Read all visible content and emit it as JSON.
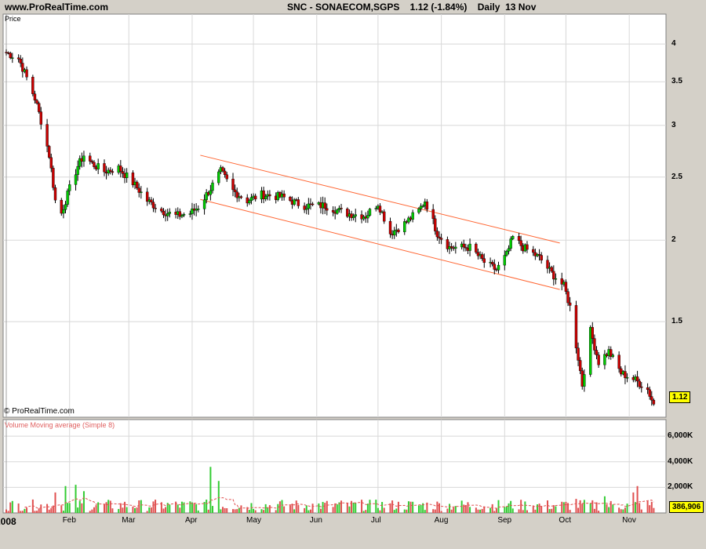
{
  "header": {
    "site": "www.ProRealTime.com",
    "ticker_line": "SNC - SONAECOM,SGPS    1.12 (-1.84%)    Daily  13 Nov"
  },
  "price_panel": {
    "label": "Price",
    "copyright": "© ProRealTime.com",
    "last_price_badge": "1.12"
  },
  "volume_panel": {
    "label": "Volume Moving average (Simple 8)",
    "last_volume_badge": "386,906"
  },
  "colors": {
    "background": "#ffffff",
    "frame": "#d4d0c8",
    "grid": "#d8d8d8",
    "up_candle": "#00cc00",
    "down_candle": "#cc0000",
    "volume_up": "#33cc33",
    "volume_down": "#e05050",
    "volume_ma": "#e05050",
    "channel": "#ff6633",
    "badge": "#ffff00"
  },
  "chart_data": {
    "type": "candlestick",
    "title": "SNC - SONAECOM,SGPS",
    "last": 1.12,
    "change_pct": -1.84,
    "date": "13 Nov",
    "y_scale": "log",
    "ylim": [
      1.1,
      4.3
    ],
    "y_ticks": [
      {
        "value": 4,
        "label": "4"
      },
      {
        "value": 3.5,
        "label": "3.5"
      },
      {
        "value": 3,
        "label": "3"
      },
      {
        "value": 2.5,
        "label": "2.5"
      },
      {
        "value": 2,
        "label": "2"
      },
      {
        "value": 1.5,
        "label": "1.5"
      }
    ],
    "x_range": [
      "2008-01-01",
      "2008-11-14"
    ],
    "x_ticks": [
      {
        "date": "2008-01-01",
        "label": "2008",
        "year": true
      },
      {
        "date": "2008-02-01",
        "label": "Feb"
      },
      {
        "date": "2008-03-01",
        "label": "Mar"
      },
      {
        "date": "2008-04-01",
        "label": "Apr"
      },
      {
        "date": "2008-05-01",
        "label": "May"
      },
      {
        "date": "2008-06-01",
        "label": "Jun"
      },
      {
        "date": "2008-07-01",
        "label": "Jul"
      },
      {
        "date": "2008-08-01",
        "label": "Aug"
      },
      {
        "date": "2008-09-01",
        "label": "Sep"
      },
      {
        "date": "2008-10-01",
        "label": "Oct"
      },
      {
        "date": "2008-11-01",
        "label": "Nov"
      }
    ],
    "volume_ylim": [
      0,
      6500000
    ],
    "volume_ticks": [
      {
        "value": 6000000,
        "label": "6,000K"
      },
      {
        "value": 4000000,
        "label": "4,000K"
      },
      {
        "value": 2000000,
        "label": "2,000K"
      }
    ],
    "close_anchors": [
      [
        "2008-01-01",
        3.88
      ],
      [
        "2008-01-07",
        3.8
      ],
      [
        "2008-01-11",
        3.55
      ],
      [
        "2008-01-15",
        3.3
      ],
      [
        "2008-01-18",
        3.05
      ],
      [
        "2008-01-22",
        2.7
      ],
      [
        "2008-01-25",
        2.3
      ],
      [
        "2008-01-28",
        2.2
      ],
      [
        "2008-01-31",
        2.35
      ],
      [
        "2008-02-05",
        2.6
      ],
      [
        "2008-02-08",
        2.7
      ],
      [
        "2008-02-12",
        2.62
      ],
      [
        "2008-02-18",
        2.55
      ],
      [
        "2008-02-25",
        2.58
      ],
      [
        "2008-03-03",
        2.45
      ],
      [
        "2008-03-10",
        2.3
      ],
      [
        "2008-03-17",
        2.22
      ],
      [
        "2008-03-24",
        2.18
      ],
      [
        "2008-03-31",
        2.2
      ],
      [
        "2008-04-04",
        2.25
      ],
      [
        "2008-04-10",
        2.4
      ],
      [
        "2008-04-15",
        2.55
      ],
      [
        "2008-04-21",
        2.38
      ],
      [
        "2008-04-28",
        2.3
      ],
      [
        "2008-05-05",
        2.35
      ],
      [
        "2008-05-15",
        2.33
      ],
      [
        "2008-05-25",
        2.26
      ],
      [
        "2008-06-05",
        2.26
      ],
      [
        "2008-06-15",
        2.2
      ],
      [
        "2008-06-25",
        2.18
      ],
      [
        "2008-07-01",
        2.28
      ],
      [
        "2008-07-07",
        2.05
      ],
      [
        "2008-07-14",
        2.12
      ],
      [
        "2008-07-21",
        2.22
      ],
      [
        "2008-07-24",
        2.3
      ],
      [
        "2008-07-30",
        2.05
      ],
      [
        "2008-08-05",
        1.95
      ],
      [
        "2008-08-15",
        1.95
      ],
      [
        "2008-08-22",
        1.85
      ],
      [
        "2008-08-28",
        1.8
      ],
      [
        "2008-09-02",
        1.9
      ],
      [
        "2008-09-05",
        2.02
      ],
      [
        "2008-09-10",
        1.95
      ],
      [
        "2008-09-18",
        1.88
      ],
      [
        "2008-09-24",
        1.78
      ],
      [
        "2008-09-30",
        1.7
      ],
      [
        "2008-10-03",
        1.58
      ],
      [
        "2008-10-06",
        1.38
      ],
      [
        "2008-10-09",
        1.2
      ],
      [
        "2008-10-13",
        1.45
      ],
      [
        "2008-10-17",
        1.3
      ],
      [
        "2008-10-22",
        1.35
      ],
      [
        "2008-10-28",
        1.25
      ],
      [
        "2008-11-04",
        1.22
      ],
      [
        "2008-11-10",
        1.18
      ],
      [
        "2008-11-13",
        1.12
      ]
    ],
    "channel": {
      "upper": [
        [
          "2008-04-05",
          2.7
        ],
        [
          "2008-09-28",
          1.98
        ]
      ],
      "lower": [
        [
          "2008-04-05",
          2.31
        ],
        [
          "2008-09-28",
          1.68
        ]
      ]
    },
    "volume_spikes": [
      [
        "2008-04-12",
        5600000
      ],
      [
        "2008-04-10",
        3600000
      ],
      [
        "2008-04-14",
        2500000
      ],
      [
        "2008-02-04",
        2200000
      ],
      [
        "2008-01-30",
        2100000
      ],
      [
        "2008-11-05",
        2100000
      ],
      [
        "2008-11-03",
        1600000
      ],
      [
        "2008-02-08",
        1700000
      ],
      [
        "2008-04-06",
        1700000
      ],
      [
        "2008-01-25",
        1600000
      ],
      [
        "2008-10-20",
        1300000
      ],
      [
        "2008-10-06",
        1100000
      ]
    ],
    "volume_typical": 500000,
    "volume_last": 386906
  }
}
